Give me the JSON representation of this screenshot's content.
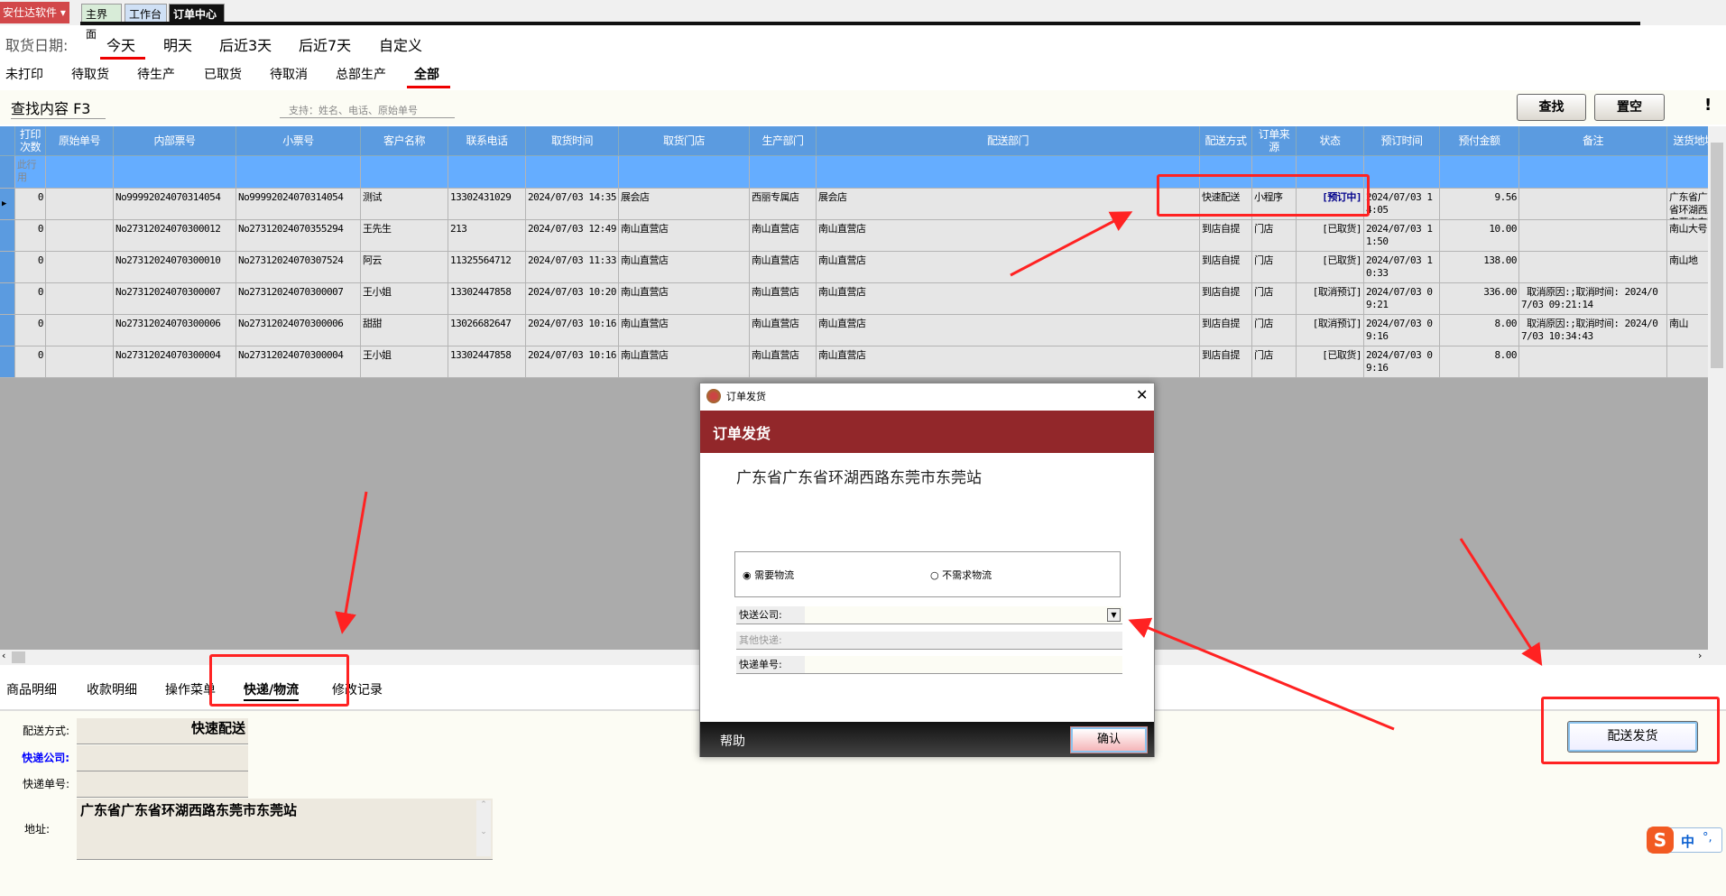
{
  "app": {
    "logo": "安仕达软件",
    "tabs": [
      "主界面",
      "工作台",
      "订单中心"
    ]
  },
  "date_filter": {
    "label": "取货日期:",
    "options": [
      "今天",
      "明天",
      "后近3天",
      "后近7天",
      "自定义"
    ]
  },
  "status_filter": [
    "未打印",
    "待取货",
    "待生产",
    "已取货",
    "待取消",
    "总部生产",
    "全部"
  ],
  "search": {
    "label": "查找内容 F3",
    "hint": "支持：姓名、电话、原始单号",
    "find": "查找",
    "clear": "置空",
    "warn": "!"
  },
  "table": {
    "columns": [
      "打印次数",
      "原始单号",
      "内部票号",
      "小票号",
      "客户名称",
      "联系电话",
      "取货时间",
      "取货门店",
      "生产部门",
      "配送部门",
      "配送方式",
      "订单来源",
      "状态",
      "预订时间",
      "预付金额",
      "备注",
      "送货地址"
    ],
    "filter_hint": "此行用",
    "rows": [
      [
        "0",
        "",
        "No99992024070314054",
        "No99992024070314054",
        "测试",
        "13302431029",
        "2024/07/03 14:35",
        "展会店",
        "西丽专属店",
        "展会店",
        "快速配送",
        "小程序",
        "[预订中]",
        "2024/07/03 14:05",
        "9.56",
        "",
        "广东省广东省环湖西路东莞市东莞站"
      ],
      [
        "0",
        "",
        "No27312024070300012",
        "No27312024070355294",
        "王先生",
        "213",
        "2024/07/03 12:49",
        "南山直营店",
        "南山直营店",
        "南山直营店",
        "到店自提",
        "门店",
        "[已取货]",
        "2024/07/03 11:50",
        "10.00",
        "",
        "南山大号"
      ],
      [
        "0",
        "",
        "No27312024070300010",
        "No27312024070307524",
        "阿云",
        "11325564712",
        "2024/07/03 11:33",
        "南山直营店",
        "南山直营店",
        "南山直营店",
        "到店自提",
        "门店",
        "[已取货]",
        "2024/07/03 10:33",
        "138.00",
        "",
        "南山地"
      ],
      [
        "0",
        "",
        "No27312024070300007",
        "No27312024070300007",
        "王小姐",
        "13302447858",
        "2024/07/03 10:20",
        "南山直营店",
        "南山直营店",
        "南山直营店",
        "到店自提",
        "门店",
        "[取消预订]",
        "2024/07/03 09:21",
        "336.00",
        " 取消原因:;取消时间: 2024/07/03 09:21:14",
        ""
      ],
      [
        "0",
        "",
        "No27312024070300006",
        "No27312024070300006",
        "甜甜",
        "13026682647",
        "2024/07/03 10:16",
        "南山直营店",
        "南山直营店",
        "南山直营店",
        "到店自提",
        "门店",
        "[取消预订]",
        "2024/07/03 09:16",
        "8.00",
        " 取消原因:;取消时间: 2024/07/03 10:34:43",
        "南山"
      ],
      [
        "0",
        "",
        "No27312024070300004",
        "No27312024070300004",
        "王小姐",
        "13302447858",
        "2024/07/03 10:16",
        "南山直营店",
        "南山直营店",
        "南山直营店",
        "到店自提",
        "门店",
        "[已取货]",
        "2024/07/03 09:16",
        "8.00",
        "",
        ""
      ]
    ]
  },
  "bottom_tabs": [
    "商品明细",
    "收款明细",
    "操作菜单",
    "快递/物流",
    "修改记录"
  ],
  "detail": {
    "delivery_label": "配送方式:",
    "delivery_value": "快速配送",
    "company_label": "快递公司:",
    "company_value": "",
    "tracking_label": "快递单号:",
    "tracking_value": "",
    "address_label": "地址:",
    "address_value": "广东省广东省环湖西路东莞市东莞站"
  },
  "ship_button": "配送发货",
  "dialog": {
    "title": "订单发货",
    "header": "订单发货",
    "address": "广东省广东省环湖西路东莞市东莞站",
    "radio_need": "需要物流",
    "radio_no": "不需求物流",
    "selected": "需要物流",
    "company_label": "快送公司:",
    "other_label": "其他快递:",
    "tracking_label": "快递单号:",
    "help": "帮助",
    "confirm": "确认"
  },
  "ime": {
    "mode": "中",
    "punct": "°,"
  }
}
